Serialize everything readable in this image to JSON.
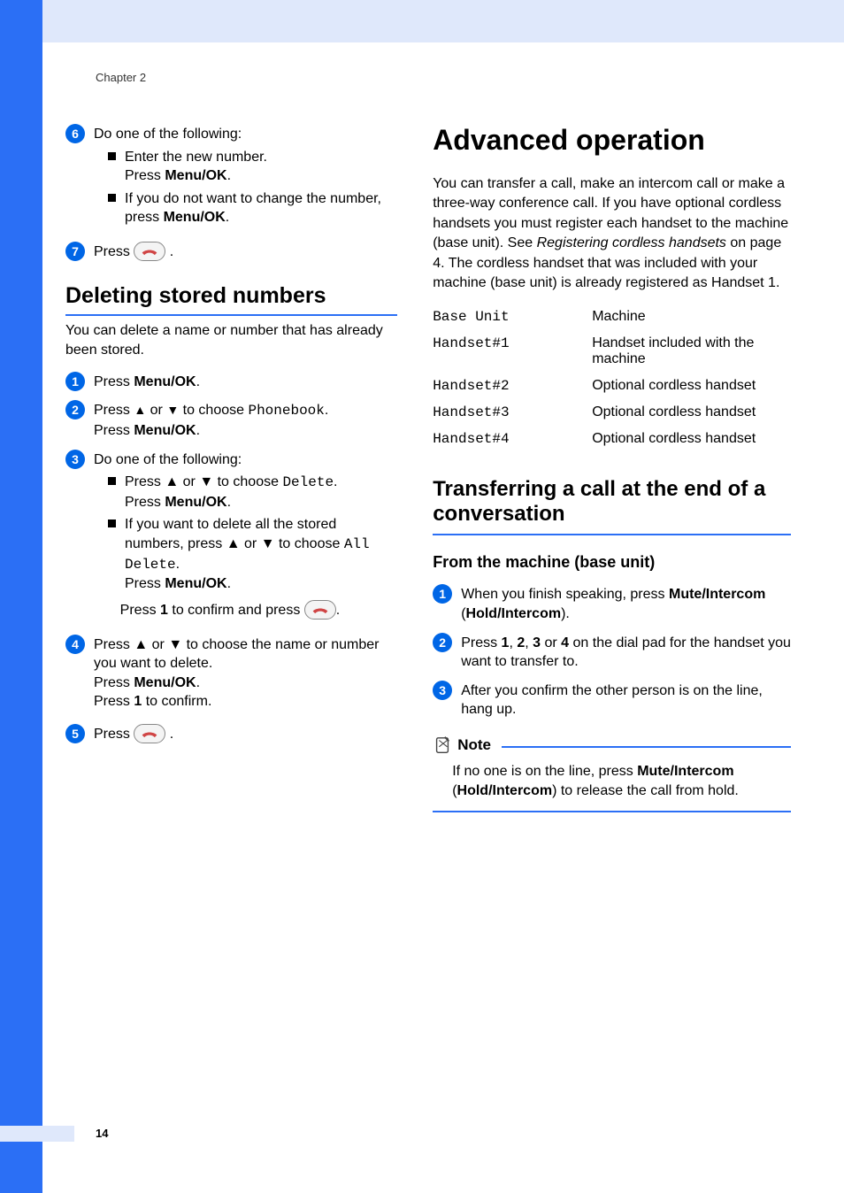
{
  "chapter_label": "Chapter 2",
  "page_number": "14",
  "left": {
    "step6": {
      "title": "Do one of the following:",
      "b1_l1": "Enter the new number.",
      "b1_l2_pre": "Press ",
      "b1_l2_bold": "Menu/OK",
      "b1_l2_post": ".",
      "b2_l1_pre": "If you do not want to change the number, press ",
      "b2_l1_bold": "Menu/OK",
      "b2_l1_post": "."
    },
    "step7": {
      "pre": "Press ",
      "post": "."
    },
    "h_deleting": "Deleting stored numbers",
    "deleting_intro": "You can delete a name or number that has already been stored.",
    "d1": {
      "pre": "Press ",
      "bold": "Menu/OK",
      "post": "."
    },
    "d2": {
      "pre": "Press ",
      "a": "▲",
      "mid1": " or ",
      "b": "▼",
      "mid2": " to choose ",
      "code": "Phonebook",
      "post1": ".",
      "l2_pre": "Press ",
      "l2_bold": "Menu/OK",
      "l2_post": "."
    },
    "d3": {
      "title": "Do one of the following:",
      "b1_pre": "Press ",
      "b1_a": "▲",
      "b1_mid": " or ",
      "b1_b": "▼",
      "b1_mid2": " to choose ",
      "b1_code": "Delete",
      "b1_post": ".",
      "b1_l2_pre": "Press ",
      "b1_l2_bold": "Menu/OK",
      "b1_l2_post": ".",
      "b2_l1_pre": "If you want to delete all the stored numbers, press ",
      "b2_a": "▲",
      "b2_mid": " or ",
      "b2_b": "▼",
      "b2_mid2": " to choose ",
      "b2_code": "All Delete",
      "b2_post": ".",
      "b2_l3_pre": "Press ",
      "b2_l3_bold": "Menu/OK",
      "b2_l3_post": ".",
      "b2_l4_pre": "Press ",
      "b2_l4_bold": "1",
      "b2_l4_mid": " to confirm and press ",
      "b2_l4_post": "."
    },
    "d4": {
      "pre": "Press ",
      "a": "▲",
      "mid1": " or ",
      "b": "▼",
      "mid2": " to choose the name or number you want to delete.",
      "l2_pre": "Press ",
      "l2_bold": "Menu/OK",
      "l2_post": ".",
      "l3_pre": "Press ",
      "l3_bold": "1",
      "l3_post": " to confirm."
    },
    "d5": {
      "pre": "Press ",
      "post": "."
    }
  },
  "right": {
    "h_adv": "Advanced operation",
    "adv_intro_pre": "You can transfer a call, make an intercom call or make a three-way conference call. If you have optional cordless handsets you must register each handset to the machine (base unit). See ",
    "adv_intro_italic": "Registering cordless handsets",
    "adv_intro_mid": " on page 4. The cordless handset that was included with your machine (base unit) is already registered as Handset 1.",
    "table": {
      "r1": {
        "c1": "Base Unit",
        "c2": "Machine"
      },
      "r2": {
        "c1": "Handset#1",
        "c2": "Handset included with the machine"
      },
      "r3": {
        "c1": "Handset#2",
        "c2": "Optional cordless handset"
      },
      "r4": {
        "c1": "Handset#3",
        "c2": "Optional cordless handset"
      },
      "r5": {
        "c1": "Handset#4",
        "c2": "Optional cordless handset"
      }
    },
    "h_transfer": "Transferring a call at the end of a conversation",
    "sub_from": "From the machine (base unit)",
    "t1": {
      "pre": "When you finish speaking, press ",
      "bold1": "Mute/Intercom",
      "mid": " (",
      "bold2": "Hold/Intercom",
      "post": ")."
    },
    "t2": {
      "pre": "Press ",
      "b1": "1",
      "c1": ", ",
      "b2": "2",
      "c2": ", ",
      "b3": "3",
      "c3": " or ",
      "b4": "4",
      "post": " on the dial pad for the handset you want to transfer to."
    },
    "t3": "After you confirm the other person is on the line, hang up.",
    "note_label": "Note",
    "note_body_pre": "If no one is on the line, press ",
    "note_bold1": "Mute/Intercom",
    "note_mid": " (",
    "note_bold2": "Hold/Intercom",
    "note_body_post": ") to release the call from hold."
  }
}
